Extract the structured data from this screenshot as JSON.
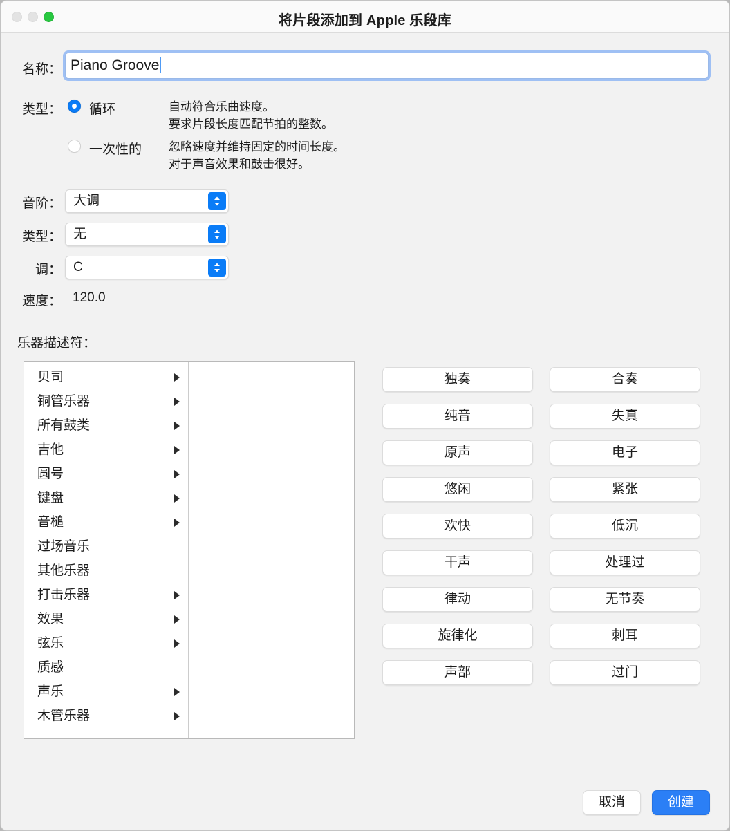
{
  "window": {
    "title": "将片段添加到 Apple 乐段库",
    "traffic_lights": {
      "close": "close-button",
      "minimize": "minimize-button",
      "zoom": "zoom-button"
    }
  },
  "name_row": {
    "label": "名称：",
    "value": "Piano Groove",
    "placeholder": ""
  },
  "type_row": {
    "label": "类型：",
    "options": [
      {
        "label": "循环",
        "selected": true,
        "description_line1": "自动符合乐曲速度。",
        "description_line2": "要求片段长度匹配节拍的整数。"
      },
      {
        "label": "一次性的",
        "selected": false,
        "description_line1": "忽略速度并维持固定的时间长度。",
        "description_line2": "对于声音效果和鼓击很好。"
      }
    ]
  },
  "popups": [
    {
      "label": "音阶：",
      "value": "大调"
    },
    {
      "label": "类型：",
      "value": "无"
    },
    {
      "label": "调：",
      "value": "C"
    }
  ],
  "tempo_row": {
    "label": "速度：",
    "value": "120.0"
  },
  "descriptors": {
    "heading": "乐器描述符：",
    "browser_items": [
      {
        "label": "贝司",
        "has_submenu": true
      },
      {
        "label": "铜管乐器",
        "has_submenu": true
      },
      {
        "label": "所有鼓类",
        "has_submenu": true
      },
      {
        "label": "吉他",
        "has_submenu": true
      },
      {
        "label": "圆号",
        "has_submenu": true
      },
      {
        "label": "键盘",
        "has_submenu": true
      },
      {
        "label": "音槌",
        "has_submenu": true
      },
      {
        "label": "过场音乐",
        "has_submenu": false
      },
      {
        "label": "其他乐器",
        "has_submenu": false
      },
      {
        "label": "打击乐器",
        "has_submenu": true
      },
      {
        "label": "效果",
        "has_submenu": true
      },
      {
        "label": "弦乐",
        "has_submenu": true
      },
      {
        "label": "质感",
        "has_submenu": false
      },
      {
        "label": "声乐",
        "has_submenu": true
      },
      {
        "label": "木管乐器",
        "has_submenu": true
      }
    ],
    "tags": [
      "独奏",
      "合奏",
      "纯音",
      "失真",
      "原声",
      "电子",
      "悠闲",
      "紧张",
      "欢快",
      "低沉",
      "干声",
      "处理过",
      "律动",
      "无节奏",
      "旋律化",
      "刺耳",
      "声部",
      "过门"
    ]
  },
  "footer": {
    "cancel_label": "取消",
    "create_label": "创建"
  },
  "colors": {
    "accent_blue": "#0a7cf7",
    "primary_button": "#2b7ff6",
    "window_background": "#f2f2f2",
    "titlebar_background": "#fafafa",
    "zoom_light_green": "#28c840"
  }
}
